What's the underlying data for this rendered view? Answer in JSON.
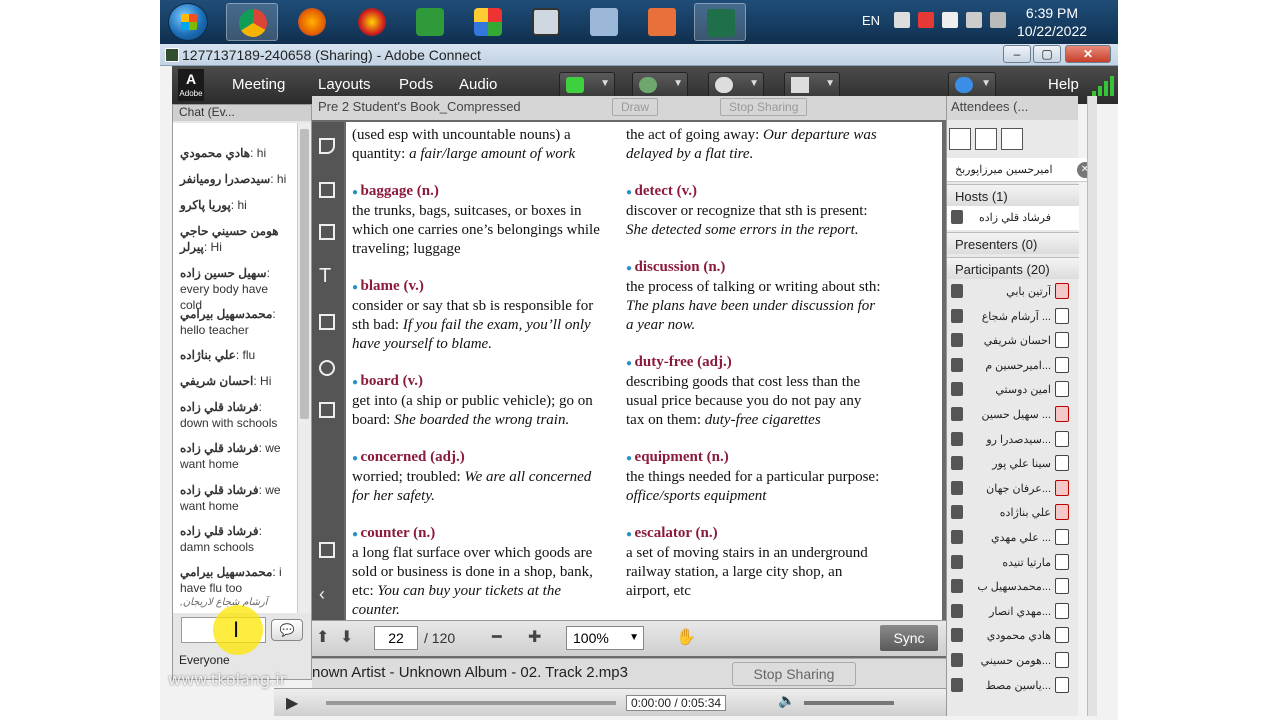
{
  "taskbar": {
    "language": "EN",
    "time": "6:39 PM",
    "date": "10/22/2022"
  },
  "window": {
    "title": "1277137189-240658 (Sharing) - Adobe Connect",
    "minimize": "–",
    "maximize": "▢",
    "close": "✕"
  },
  "menubar": {
    "logo": "Adobe",
    "items": [
      "Meeting",
      "Layouts",
      "Pods",
      "Audio"
    ],
    "help": "Help"
  },
  "chat": {
    "pod_title": "Chat (Ev...",
    "messages": [
      {
        "who": "هادي محمودي",
        "text": ": hi"
      },
      {
        "who": "سيدصدرا روميانفر",
        "text": ": hi"
      },
      {
        "who": "پوريا پاکرو",
        "text": ": hi"
      },
      {
        "who": "هومن حسيني حاجي پيرلر",
        "text": ": Hi"
      },
      {
        "who": "سهيل حسين زاده",
        "text": ": every body have cold"
      },
      {
        "who": "محمدسهيل بيرامي",
        "text": ": hello teacher"
      },
      {
        "who": "علي بناژاده",
        "text": ": flu"
      },
      {
        "who": "احسان شريفي",
        "text": ": Hi"
      },
      {
        "who": "فرشاد قلي زاده",
        "text": ": down with schools"
      },
      {
        "who": "فرشاد قلي زاده",
        "text": ": we want home"
      },
      {
        "who": "فرشاد قلي زاده",
        "text": ": we want home"
      },
      {
        "who": "فرشاد قلي زاده",
        "text": ": damn schools"
      },
      {
        "who": "محمدسهيل بيرامي",
        "text": ": i have flu too"
      }
    ],
    "typing_notice": "آرشام شجاع لاريجان, سهيل...",
    "recipient": "Everyone",
    "watermark": "www.tkolang.ir"
  },
  "share": {
    "pod_title": "Pre 2 Student's Book_Compressed",
    "draw_label": "Draw",
    "stop_sharing": "Stop Sharing",
    "page": "22",
    "page_total": "/ 120",
    "zoom": "100%",
    "sync": "Sync",
    "left_column": [
      {
        "headword": "",
        "def": "(used esp with uncountable nouns) a quantity: ",
        "example": "a fair/large amount of work"
      },
      {
        "headword": "baggage (n.)",
        "def": "the trunks, bags, suitcases, or boxes in which one carries one’s belongings while traveling; luggage",
        "example": ""
      },
      {
        "headword": "blame (v.)",
        "def": "consider or say that sb is responsible for sth bad: ",
        "example": "If you fail the exam, you’ll only have yourself to blame."
      },
      {
        "headword": "board (v.)",
        "def": "get into (a ship or public vehicle); go on board: ",
        "example": "She boarded the wrong train."
      },
      {
        "headword": "concerned (adj.)",
        "def": "worried; troubled: ",
        "example": "We are all concerned for her safety."
      },
      {
        "headword": "counter (n.)",
        "def": "a long flat surface over which goods are sold or business is done in a shop, bank, etc: ",
        "example": "You can buy your tickets at the counter."
      }
    ],
    "right_column": [
      {
        "headword": "",
        "def": "the act of going away: ",
        "example": "Our departure was delayed by a flat tire."
      },
      {
        "headword": "detect (v.)",
        "def": "discover or recognize that sth is present: ",
        "example": "She detected some errors in the report."
      },
      {
        "headword": "discussion (n.)",
        "def": "the process of talking or writing about sth: ",
        "example": "The plans have been under discussion for a year now."
      },
      {
        "headword": "duty-free (adj.)",
        "def": "describing goods that cost less than the usual price because you do not pay any tax on them: ",
        "example": "duty-free cigarettes"
      },
      {
        "headword": "equipment (n.)",
        "def": "the things needed for a particular purpose: ",
        "example": "office/sports equipment"
      },
      {
        "headword": "escalator (n.)",
        "def": "a set of moving stairs in an underground railway station, a large city shop, an airport, etc",
        "example": ""
      }
    ]
  },
  "audio": {
    "track": "nown Artist - Unknown Album - 02. Track 2.mp3",
    "stop_sharing": "Stop Sharing",
    "time": "0:00:00 / 0:05:34"
  },
  "attendees": {
    "pod_title": "Attendees (...",
    "me": "اميرحسين ميرزاپوربخ",
    "hosts_label": "Hosts (1)",
    "host": "فرشاد قلي زاده",
    "presenters_label": "Presenters (0)",
    "participants_label": "Participants (20)",
    "participants": [
      {
        "name": "آرتين بابي",
        "muted": true
      },
      {
        "name": "آرشام شجاع ...",
        "muted": false
      },
      {
        "name": "احسان شريفي",
        "muted": false
      },
      {
        "name": "اميرحسين م...",
        "muted": false
      },
      {
        "name": "امين دوستي",
        "muted": false
      },
      {
        "name": "سهيل حسين ...",
        "muted": true
      },
      {
        "name": "سيدصدرا رو...",
        "muted": false
      },
      {
        "name": "سينا علي پور",
        "muted": false
      },
      {
        "name": "عرفان جهان...",
        "muted": true
      },
      {
        "name": "علي بناژاده",
        "muted": true
      },
      {
        "name": "علي مهدي ...",
        "muted": false
      },
      {
        "name": "مارتيا تنيده",
        "muted": false
      },
      {
        "name": "محمدسهيل ب...",
        "muted": false
      },
      {
        "name": "مهدي انصار...",
        "muted": false
      },
      {
        "name": "هادي محمودي",
        "muted": false
      },
      {
        "name": "هومن حسيني...",
        "muted": false
      },
      {
        "name": "ياسين مصط...",
        "muted": false
      }
    ]
  }
}
